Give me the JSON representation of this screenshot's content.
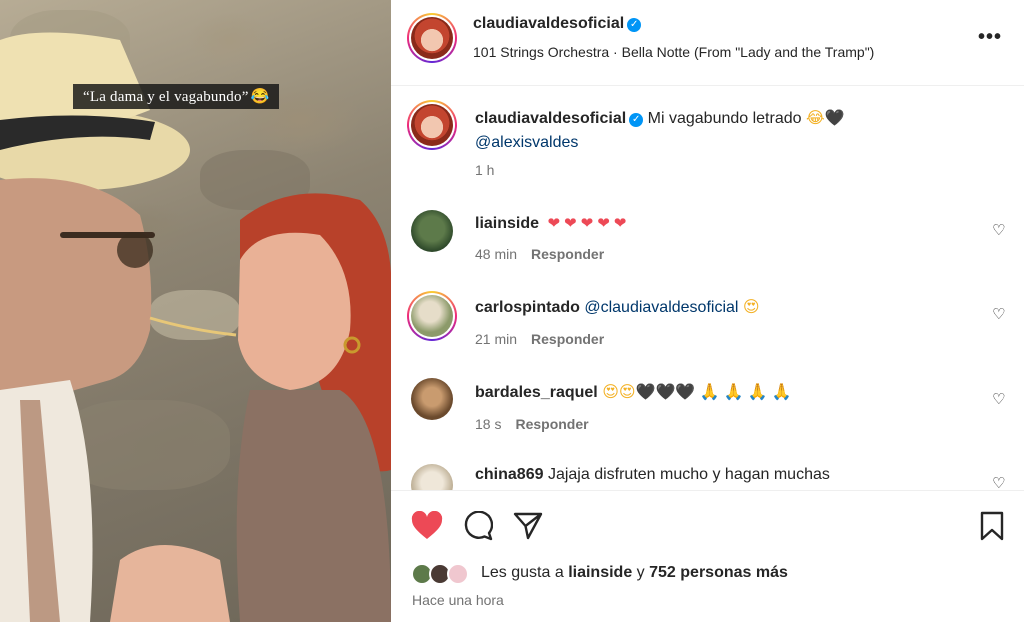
{
  "photo": {
    "caption": "“La dama y el vagabundo”",
    "caption_emoji": "😂"
  },
  "header": {
    "username": "claudiavaldesoficial",
    "verified": true,
    "audio": "101 Strings Orchestra · Bella Notte (From \"Lady and the Tramp\")",
    "more": "•••"
  },
  "post": {
    "username": "claudiavaldesoficial",
    "text": "Mi vagabundo letrado",
    "emojis": "😂🖤",
    "mention": "@alexisvaldes",
    "time": "1 h"
  },
  "comments": [
    {
      "username": "liainside",
      "text": "",
      "emojis": "❤❤❤❤❤",
      "time": "48 min",
      "reply": "Responder"
    },
    {
      "username": "carlospintado",
      "text": "",
      "mention": "@claudiavaldesoficial",
      "emojis": "😍",
      "time": "21 min",
      "reply": "Responder"
    },
    {
      "username": "bardales_raquel",
      "text": "",
      "emojis_a": "😍😍",
      "emojis_b": "🖤🖤🖤",
      "emojis_c": "🙏🙏🙏🙏",
      "time": "18 s",
      "reply": "Responder"
    },
    {
      "username": "china869",
      "text": "Jajaja disfruten mucho y hagan muchas"
    }
  ],
  "likes": {
    "prefix": "Les gusta a",
    "user": "liainside",
    "joiner": "y",
    "count": "752 personas más"
  },
  "posted": "Hace una hora",
  "colors": {
    "liked": "#ed4956",
    "verified": "#0095f6",
    "muted": "#737373",
    "link": "#00376b"
  }
}
